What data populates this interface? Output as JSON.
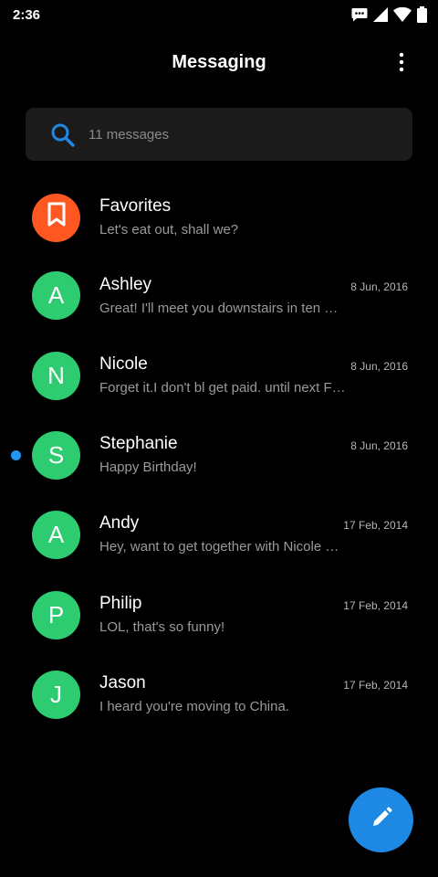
{
  "status_bar": {
    "time": "2:36",
    "icons": [
      "message-notification-icon",
      "signal-icon",
      "wifi-icon",
      "battery-icon"
    ]
  },
  "app_bar": {
    "title": "Messaging",
    "menu_icon": "more-vert-icon"
  },
  "search": {
    "icon": "search-icon",
    "placeholder": "11 messages"
  },
  "colors": {
    "background": "#000000",
    "search_bg": "#1b1b1b",
    "accent_blue": "#1e88e5",
    "avatar_green": "#2ecc71",
    "favorites_orange": "#ff5722",
    "unread_dot": "#2196f3"
  },
  "conversations": [
    {
      "avatar": "",
      "avatar_icon": "bookmark-icon",
      "name": "Favorites",
      "snippet": "Let's eat out, shall we?",
      "date": "",
      "unread": false
    },
    {
      "avatar": "A",
      "name": "Ashley",
      "snippet": "Great! I'll meet you downstairs in ten …",
      "date": "8 Jun, 2016",
      "unread": false
    },
    {
      "avatar": "N",
      "name": "Nicole",
      "snippet": "Forget it.I don't bl get paid. until next F…",
      "date": "8 Jun, 2016",
      "unread": false
    },
    {
      "avatar": "S",
      "name": "Stephanie",
      "snippet": "Happy Birthday!",
      "date": "8 Jun, 2016",
      "unread": true
    },
    {
      "avatar": "A",
      "name": "Andy",
      "snippet": "Hey, want to get together with Nicole …",
      "date": "17 Feb, 2014",
      "unread": false
    },
    {
      "avatar": "P",
      "name": "Philip",
      "snippet": "LOL, that's so funny!",
      "date": "17 Feb, 2014",
      "unread": false
    },
    {
      "avatar": "J",
      "name": "Jason",
      "snippet": "I heard you're moving to China.",
      "date": "17 Feb, 2014",
      "unread": false
    }
  ],
  "fab": {
    "icon": "pencil-icon"
  }
}
